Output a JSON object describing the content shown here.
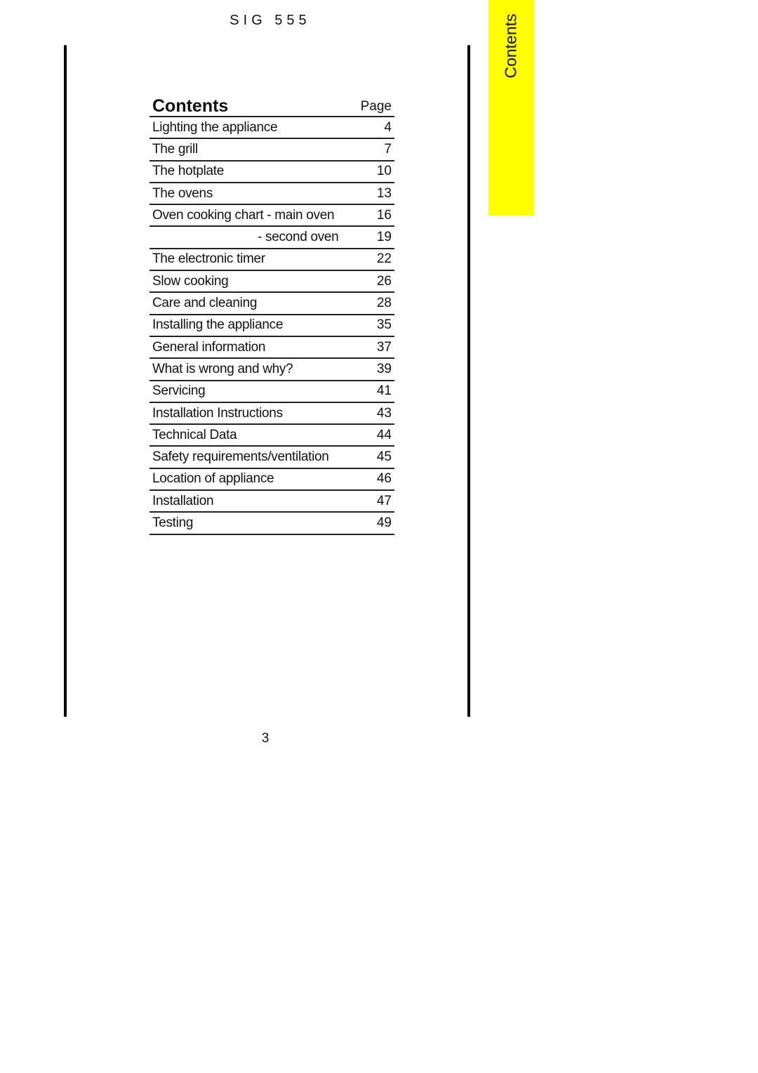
{
  "header": {
    "model": "SIG 555"
  },
  "side_tab": {
    "label": "Contents",
    "color": "#ffff00"
  },
  "toc": {
    "title": "Contents",
    "page_column_label": "Page",
    "entries": [
      {
        "label": "Lighting the appliance",
        "page": "4"
      },
      {
        "label": "The grill",
        "page": "7"
      },
      {
        "label": "The hotplate",
        "page": "10"
      },
      {
        "label": "The ovens",
        "page": "13"
      },
      {
        "label": "Oven cooking chart - main oven",
        "page": "16"
      },
      {
        "label": "- second oven",
        "page": "19",
        "indent": true
      },
      {
        "label": "The electronic timer",
        "page": "22"
      },
      {
        "label": "Slow cooking",
        "page": "26"
      },
      {
        "label": "Care and cleaning",
        "page": "28"
      },
      {
        "label": "Installing the appliance",
        "page": "35"
      },
      {
        "label": "General information",
        "page": "37"
      },
      {
        "label": "What is wrong and why?",
        "page": "39"
      },
      {
        "label": "Servicing",
        "page": "41"
      },
      {
        "label": "Installation Instructions",
        "page": "43"
      },
      {
        "label": "Technical Data",
        "page": "44"
      },
      {
        "label": "Safety requirements/ventilation",
        "page": "45"
      },
      {
        "label": "Location of appliance",
        "page": "46"
      },
      {
        "label": "Installation",
        "page": "47"
      },
      {
        "label": "Testing",
        "page": "49"
      }
    ]
  },
  "footer": {
    "page_number": "3"
  }
}
